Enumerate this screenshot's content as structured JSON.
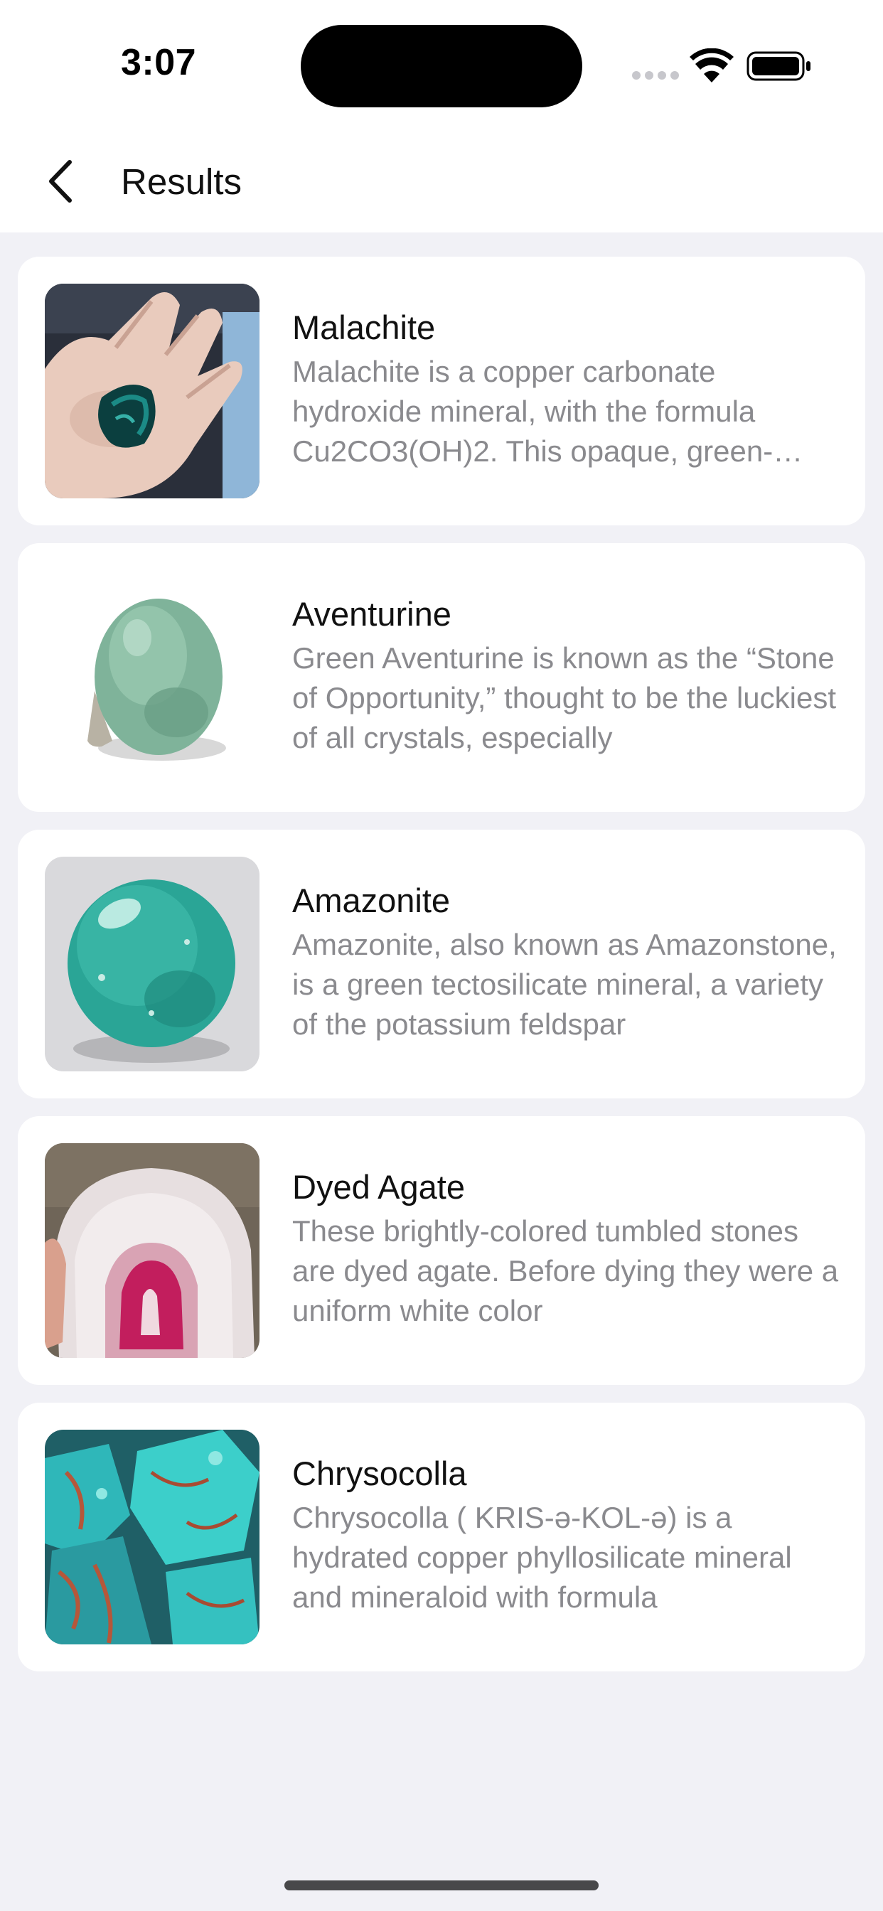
{
  "status": {
    "time": "3:07"
  },
  "header": {
    "title": "Results"
  },
  "results": [
    {
      "name": "Malachite",
      "description": "Malachite is a copper carbonate hydroxide mineral, with the formula Cu2CO3(OH)2. This opaque, green-banded mineral"
    },
    {
      "name": "Aventurine",
      "description": "Green Aventurine is known as the “Stone of Opportunity,” thought to be the luckiest of all crystals, especially"
    },
    {
      "name": "Amazonite",
      "description": "Amazonite, also known as Amazonstone, is a green tectosilicate mineral, a variety of the potassium feldspar"
    },
    {
      "name": "Dyed Agate",
      "description": "These brightly-colored tumbled stones are dyed agate. Before dying they were a uniform white color"
    },
    {
      "name": "Chrysocolla",
      "description": "Chrysocolla ( KRIS-ə-KOL-ə) is a hydrated copper phyllosilicate mineral and mineraloid with formula"
    }
  ],
  "colors": {
    "background": "#f1f1f6",
    "card": "#ffffff",
    "title_text": "#111111",
    "description_text": "#8a8a8e"
  }
}
